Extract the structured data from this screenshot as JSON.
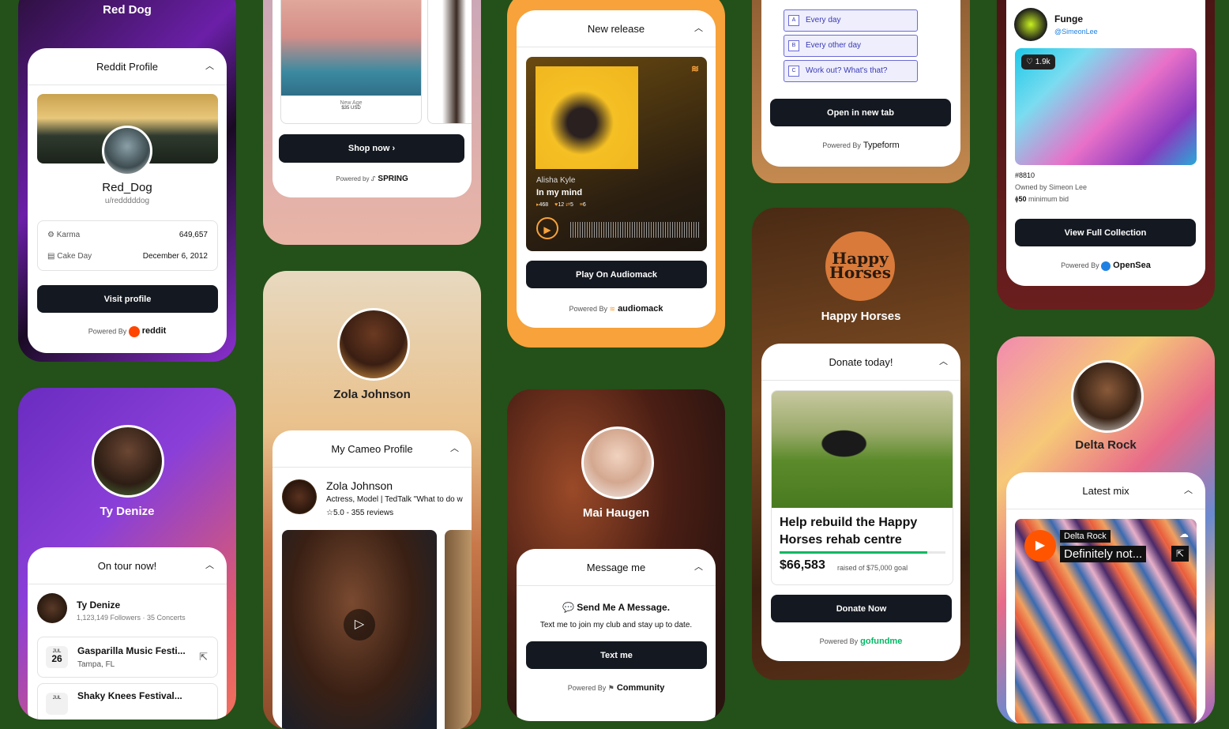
{
  "reddit": {
    "top_name": "Red Dog",
    "card_title": "Reddit Profile",
    "display_name": "Red_Dog",
    "handle": "u/redddddog",
    "rows": [
      {
        "label": "Karma",
        "value": "649,657"
      },
      {
        "label": "Cake Day",
        "value": "December 6, 2012"
      }
    ],
    "button": "Visit profile",
    "powered": "Powered By",
    "brand": "reddit"
  },
  "spring": {
    "product_name": "New Age",
    "product_price": "$35 USD",
    "button": "Shop now",
    "powered": "Powered by",
    "brand": "SPRING"
  },
  "audiomack": {
    "card_title": "New release",
    "artist": "Alisha Kyle",
    "track": "In my mind",
    "stats": {
      "plays": "468",
      "likes": "12",
      "reposts": "5",
      "playlists": "6"
    },
    "button": "Play On Audiomack",
    "powered": "Powered By",
    "brand": "audiomack"
  },
  "typeform": {
    "options": [
      {
        "key": "A",
        "label": "Every day"
      },
      {
        "key": "B",
        "label": "Every other day"
      },
      {
        "key": "C",
        "label": "Work out? What's that?"
      }
    ],
    "button": "Open in new tab",
    "powered": "Powered By",
    "brand": "Typeform"
  },
  "opensea": {
    "creator": "Funge",
    "handle": "@SimeonLee",
    "likes": "1.9k",
    "token": "#8810",
    "owner": "Owned by Simeon Lee",
    "bid": "50",
    "bid_label": "minimum bid",
    "button": "View Full Collection",
    "powered": "Powered By",
    "brand": "OpenSea"
  },
  "cameo": {
    "name": "Zola Johnson",
    "card_title": "My Cameo Profile",
    "profile_name": "Zola Johnson",
    "bio": "Actress, Model | TedTalk \"What to do w",
    "rating": "5.0 - 355 reviews"
  },
  "tour": {
    "name": "Ty Denize",
    "card_title": "On tour now!",
    "artist": "Ty Denize",
    "stats": "1,123,149 Followers · 35 Concerts",
    "events": [
      {
        "month": "JUL",
        "day": "26",
        "title": "Gasparilla Music Festi...",
        "location": "Tampa, FL"
      },
      {
        "month": "JUL",
        "day": "",
        "title": "Shaky Knees Festival...",
        "location": ""
      }
    ]
  },
  "community": {
    "name": "Mai Haugen",
    "card_title": "Message me",
    "heading": "Send Me A Message.",
    "body": "Text me to join my club and stay up to date.",
    "button": "Text me",
    "powered": "Powered By",
    "brand": "Community"
  },
  "gofundme": {
    "logo_text": "Happy Horses",
    "name": "Happy Horses",
    "card_title": "Donate today!",
    "headline": "Help rebuild the Happy Horses rehab centre",
    "raised": "$66,583",
    "goal_text": "raised of $75,000 goal",
    "progress": 0.89,
    "button": "Donate Now",
    "powered": "Powered By",
    "brand": "gofundme"
  },
  "soundcloud": {
    "name": "Delta Rock",
    "card_title": "Latest mix",
    "artist": "Delta Rock",
    "track": "Definitely not..."
  },
  "colors": {
    "bg": "#245019",
    "button": "#141820",
    "accent_orange": "#f7a23b",
    "gofund_green": "#00b964"
  }
}
